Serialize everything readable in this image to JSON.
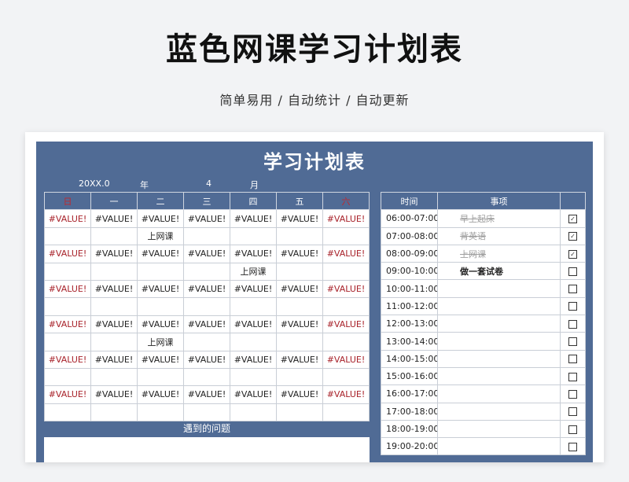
{
  "header": {
    "title": "蓝色网课学习计划表",
    "subtitle": "简单易用 / 自动统计 / 自动更新"
  },
  "sheet": {
    "title": "学习计划表",
    "year_value": "20XX.0",
    "year_label": "年",
    "month_value": "4",
    "month_label": "月",
    "issues_label": "遇到的问题"
  },
  "calendar": {
    "weekdays": [
      "日",
      "一",
      "二",
      "三",
      "四",
      "五",
      "六"
    ],
    "weekend_color": "#c0282d",
    "rows": [
      [
        "#VALUE!",
        "#VALUE!",
        "#VALUE!",
        "#VALUE!",
        "#VALUE!",
        "#VALUE!",
        "#VALUE!"
      ],
      [
        "",
        "",
        "上网课",
        "",
        "",
        "",
        ""
      ],
      [
        "#VALUE!",
        "#VALUE!",
        "#VALUE!",
        "#VALUE!",
        "#VALUE!",
        "#VALUE!",
        "#VALUE!"
      ],
      [
        "",
        "",
        "",
        "",
        "上网课",
        "",
        ""
      ],
      [
        "#VALUE!",
        "#VALUE!",
        "#VALUE!",
        "#VALUE!",
        "#VALUE!",
        "#VALUE!",
        "#VALUE!"
      ],
      [
        "",
        "",
        "",
        "",
        "",
        "",
        ""
      ],
      [
        "#VALUE!",
        "#VALUE!",
        "#VALUE!",
        "#VALUE!",
        "#VALUE!",
        "#VALUE!",
        "#VALUE!"
      ],
      [
        "",
        "",
        "上网课",
        "",
        "",
        "",
        ""
      ],
      [
        "#VALUE!",
        "#VALUE!",
        "#VALUE!",
        "#VALUE!",
        "#VALUE!",
        "#VALUE!",
        "#VALUE!"
      ],
      [
        "",
        "",
        "",
        "",
        "",
        "",
        ""
      ],
      [
        "#VALUE!",
        "#VALUE!",
        "#VALUE!",
        "#VALUE!",
        "#VALUE!",
        "#VALUE!",
        "#VALUE!"
      ],
      [
        "",
        "",
        "",
        "",
        "",
        "",
        ""
      ]
    ]
  },
  "schedule": {
    "headers": [
      "时间",
      "事项",
      ""
    ],
    "rows": [
      {
        "time": "06:00-07:00",
        "item": "早上起床",
        "status": "done",
        "checked": true
      },
      {
        "time": "07:00-08:00",
        "item": "背英语",
        "status": "done",
        "checked": true
      },
      {
        "time": "08:00-09:00",
        "item": "上网课",
        "status": "done",
        "checked": true
      },
      {
        "time": "09:00-10:00",
        "item": "做一套试卷",
        "status": "todo",
        "checked": false
      },
      {
        "time": "10:00-11:00",
        "item": "",
        "status": "empty",
        "checked": false
      },
      {
        "time": "11:00-12:00",
        "item": "",
        "status": "empty",
        "checked": false
      },
      {
        "time": "12:00-13:00",
        "item": "",
        "status": "empty",
        "checked": false
      },
      {
        "time": "13:00-14:00",
        "item": "",
        "status": "empty",
        "checked": false
      },
      {
        "time": "14:00-15:00",
        "item": "",
        "status": "empty",
        "checked": false
      },
      {
        "time": "15:00-16:00",
        "item": "",
        "status": "empty",
        "checked": false
      },
      {
        "time": "16:00-17:00",
        "item": "",
        "status": "empty",
        "checked": false
      },
      {
        "time": "17:00-18:00",
        "item": "",
        "status": "empty",
        "checked": false
      },
      {
        "time": "18:00-19:00",
        "item": "",
        "status": "empty",
        "checked": false
      },
      {
        "time": "19:00-20:00",
        "item": "",
        "status": "empty",
        "checked": false
      }
    ]
  },
  "colors": {
    "sheet_blue": "#506b95",
    "weekend_red": "#c0282d",
    "done_gray": "#a0a0a0"
  }
}
